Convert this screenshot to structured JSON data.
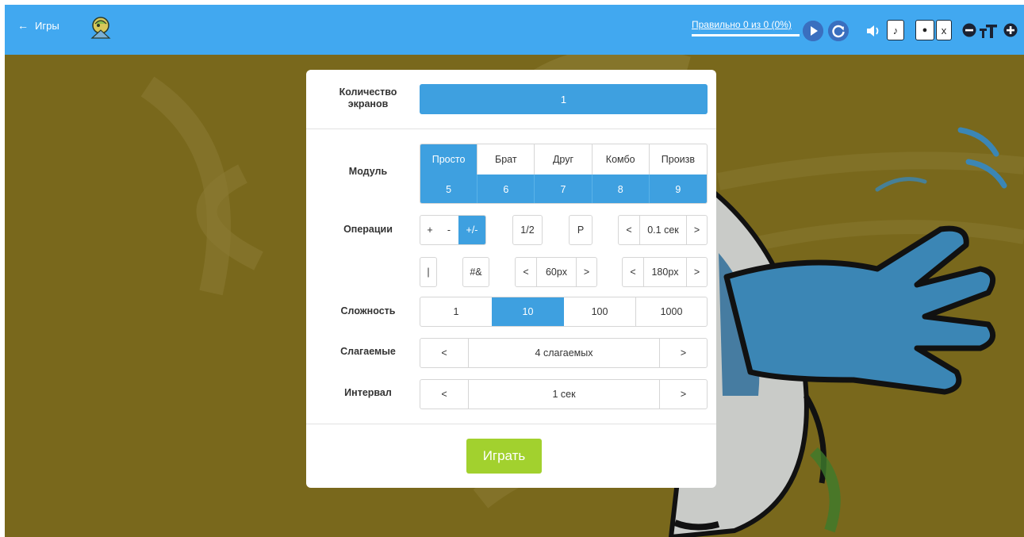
{
  "header": {
    "back_label": "Игры",
    "score_text": "Правильно 0 из 0 (0%)",
    "sq_note": "♪",
    "sq_dot": "●",
    "sq_x": "x",
    "accent": "#41a8f0"
  },
  "settings": {
    "screens": {
      "label": "Количество экранов",
      "value": "1"
    },
    "module": {
      "label": "Модуль",
      "names": [
        "Просто",
        "Брат",
        "Друг",
        "Комбо",
        "Произв"
      ],
      "numbers": [
        "5",
        "6",
        "7",
        "8",
        "9"
      ],
      "selected": 0
    },
    "operations": {
      "label": "Операции",
      "plus": "+",
      "minus": "-",
      "plusminus": "+/-",
      "half": "1/2",
      "p": "P",
      "dec": "<",
      "inc": ">",
      "time": "0.1 сек",
      "bar": "|",
      "hash": "#&",
      "width": "60px",
      "height": "180px"
    },
    "difficulty": {
      "label": "Сложность",
      "options": [
        "1",
        "10",
        "100",
        "1000"
      ],
      "selected": 1
    },
    "addends": {
      "label": "Слагаемые",
      "dec": "<",
      "value": "4 слагаемых",
      "inc": ">"
    },
    "interval": {
      "label": "Интервал",
      "dec": "<",
      "value": "1 сек",
      "inc": ">"
    },
    "play_label": "Играть"
  },
  "colors": {
    "primary": "#3ea0e0",
    "play": "#a2d12e",
    "background": "#79681c"
  }
}
